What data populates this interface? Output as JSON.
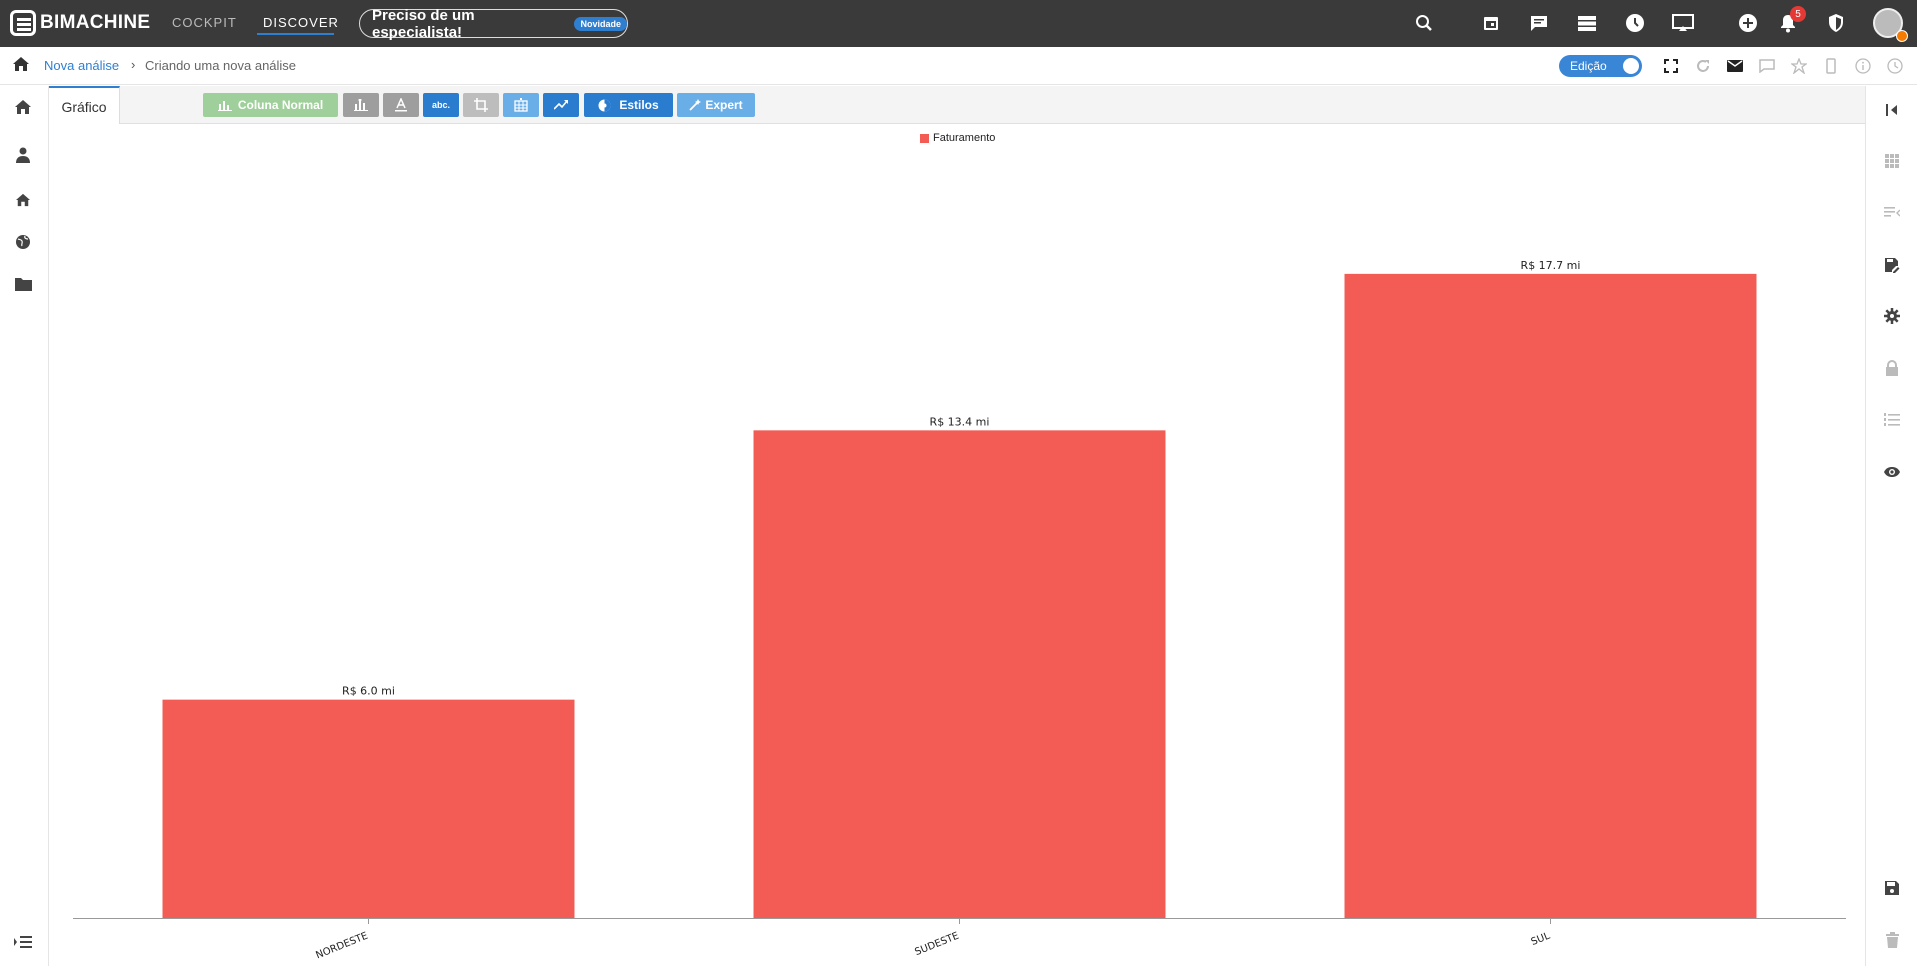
{
  "brand": {
    "name": "BIMACHINE"
  },
  "nav": {
    "cockpit": "COCKPIT",
    "discover": "DISCOVER"
  },
  "promo": {
    "label": "Preciso de um especialista!",
    "badge": "Novidade"
  },
  "notifications": {
    "count": "5"
  },
  "breadcrumb": {
    "root": "Nova análise",
    "separator": "›",
    "current": "Criando uma nova análise"
  },
  "mode": {
    "label": "Edição",
    "toggle_state": "on"
  },
  "tabs": [
    {
      "label": "Gráfico"
    }
  ],
  "toolbar": {
    "chart_type_label": "Coluna Normal",
    "small_text": "abc.",
    "styles_label": "Estilos",
    "expert_label": "Expert"
  },
  "colors": {
    "topbar": "#3a3a3a",
    "accent": "#2f7fd1",
    "bar": "#f25c54",
    "chart_type_btn": "#9fcf9a"
  },
  "chart_data": {
    "type": "bar",
    "categories": [
      "NORDESTE",
      "SUDESTE",
      "SUL"
    ],
    "series": [
      {
        "name": "Faturamento",
        "values": [
          6.0,
          13.4,
          17.7
        ],
        "labels": [
          "R$ 6.0 mi",
          "R$ 13.4 mi",
          "R$ 17.7 mi"
        ],
        "color": "#f25c54"
      }
    ],
    "ylim": [
      0,
      19.4
    ],
    "legend": "top-center",
    "grid": false
  }
}
